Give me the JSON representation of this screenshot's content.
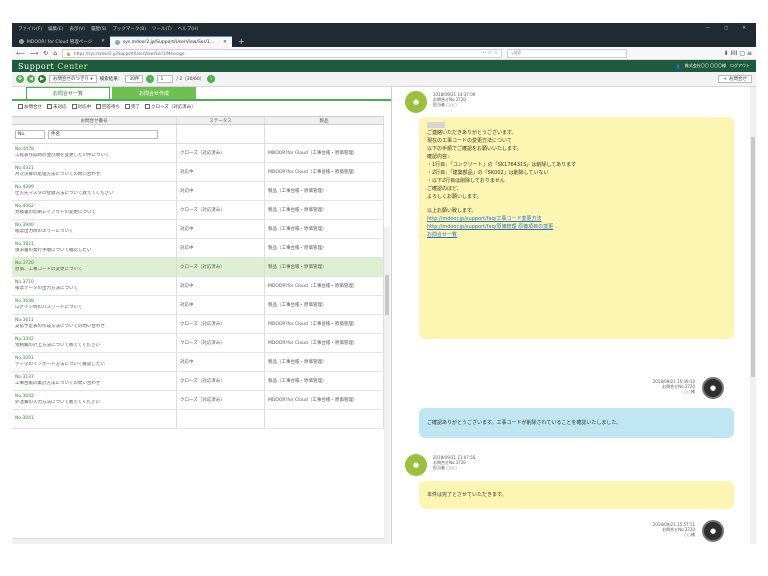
{
  "browser": {
    "menu": [
      "ファイル(F)",
      "編集(E)",
      "表示(V)",
      "履歴(S)",
      "ブックマーク(B)",
      "ツール(T)",
      "ヘルプ(H)"
    ],
    "window_controls": [
      "—",
      "□",
      "✕"
    ],
    "tabs": [
      {
        "label": "MDOOR! for Cloud 管理ページ",
        "active": false
      },
      {
        "label": "sys.mdoor2.jp/Support/UserView/Ser/1...",
        "active": true
      }
    ],
    "new_tab": "+",
    "address": "https://sys.mdoor2.jp/Support/UserView/Ser/1/Message",
    "page_actions": "··· ☆ ☆",
    "search_placeholder": "検索",
    "nav_right": "⬇ IIII ▢ ≡"
  },
  "app": {
    "logo_a": "Support",
    "logo_b": "Center",
    "user": "株式会社〇〇 〇〇〇様",
    "logout": "ログアウト"
  },
  "toolbar": {
    "category": "お問合せのつきり ▾",
    "results_label": "検索結果：",
    "results_count": "30件",
    "page_value": "1",
    "page_total": "/ 2（30/60）",
    "right_button": "お問合せ"
  },
  "left": {
    "tabs": [
      "お問合せ一覧",
      "お問合せ作成"
    ],
    "filters": [
      "お問合せ",
      "未対応",
      "対応中",
      "回答待ち",
      "完了",
      "クローズ（対応済み）"
    ],
    "columns": [
      "お問合せ番号",
      "ステータス",
      "製品"
    ],
    "filter_no": "No.",
    "filter_title": "件名",
    "rows": [
      {
        "no": "No.4478",
        "title": "工程表作成時の並び順を変更したい件について",
        "status": "クローズ（対応済み）",
        "product": "MDOOR!for Cloud（工事台帳・原価管理）",
        "hl": false
      },
      {
        "no": "No.4321",
        "title": "月次決算の処理方法についての問い合わせ",
        "status": "対応中",
        "product": "MDOOR!for Cloud（工事台帳・原価管理）",
        "hl": false
      },
      {
        "no": "No.4099",
        "title": "仕入先マスタの登録方法について教えてください",
        "status": "対応中",
        "product": "製品（工事台帳・原価管理）",
        "hl": false
      },
      {
        "no": "No.4062",
        "title": "見積書の印刷レイアウトの変更について",
        "status": "クローズ（対応済み）",
        "product": "製品（工事台帳・原価管理）",
        "hl": false
      },
      {
        "no": "No.3940",
        "title": "帳票出力時のエラーについて",
        "status": "対応中",
        "product": "製品（工事台帳・原価管理）",
        "hl": false
      },
      {
        "no": "No.3821",
        "title": "請求書の発行手順について確認したい",
        "status": "対応中",
        "product": "製品（工事台帳・原価管理）",
        "hl": false
      },
      {
        "no": "No.3720",
        "title": "原価、工事コードの変更について",
        "status": "クローズ（対応済み）",
        "product": "製品（工事台帳・原価管理）",
        "hl": true
      },
      {
        "no": "No.3710",
        "title": "帳票データの出力方法について",
        "status": "対応中",
        "product": "MDOOR!for Cloud（工事台帳・原価管理）",
        "hl": false
      },
      {
        "no": "No.3638",
        "title": "ログイン時のパスワードについて",
        "status": "対応中",
        "product": "製品（工事台帳・原価管理）",
        "hl": false
      },
      {
        "no": "No.3611",
        "title": "支払予定表の作成方法についての問い合わせ",
        "status": "クローズ（対応済み）",
        "product": "MDOOR!for Cloud（工事台帳・原価管理）",
        "hl": false
      },
      {
        "no": "No.3342",
        "title": "労務費の計上方法について教えてください",
        "status": "クローズ（対応済み）",
        "product": "MDOOR!for Cloud（工事台帳・原価管理）",
        "hl": false
      },
      {
        "no": "No.3201",
        "title": "データのインポート方法について確認したい",
        "status": "対応中",
        "product": "製品（工事台帳・原価管理）",
        "hl": false
      },
      {
        "no": "No.3137",
        "title": "工事台帳の集計方法についての問い合わせ",
        "status": "クローズ（対応済み）",
        "product": "製品（工事台帳・原価管理）",
        "hl": false
      },
      {
        "no": "No.3042",
        "title": "外注費の入力方法について教えてください",
        "status": "クローズ（対応済み）",
        "product": "MDOOR!for Cloud（工事台帳・原価管理）",
        "hl": false
      },
      {
        "no": "No.3041",
        "title": "",
        "status": "",
        "product": "",
        "hl": false
      }
    ]
  },
  "chat": {
    "m1_meta": [
      "2018/09/21 14:37:09",
      "お問合せNo.3720",
      "担当者 ○○○"
    ],
    "m1_hidden": "○○○様",
    "m1_lines": [
      "ご連絡いただきありがとうございます。",
      "現在の工事コードの変更方法について",
      "以下の手順でご確認をお願いいたします。",
      "確認内容：",
      "・1行目：「コンクリート」の「SK176431S」は削除してあります",
      "・2行目：「建築部品」の「SK002」は削除していない",
      "・以下2行目は削除しておりません",
      "ご確認のほど、",
      "よろしくお願いします。",
      "",
      "以上お願い致します。"
    ],
    "m1_link1": "http://mdoor.jp/support/faq/工事コード変更方法",
    "m1_link2": "http://mdoor.jp/support/faq/原価管理 原価項目の変更",
    "m1_link3": "お問合せ一覧",
    "m2_meta": [
      "2018/09/21 15:49:10",
      "お問合せNo.3720",
      "○○様"
    ],
    "m2_text": "ご確認ありがとうございます。工事コードが削除されていることを確認いたしました。",
    "m3_meta": [
      "2018/09/21 11:07:55",
      "お問合せNo.3720",
      "担当者 ○○○"
    ],
    "m3_text": "本件は完了とさせていただきます。",
    "m4_meta": [
      "2018/09/21 15:57:11",
      "お問合せNo.3720",
      "○○様"
    ]
  },
  "colors": {
    "app_header": "#1e5a3e",
    "accent_green": "#4caf50",
    "bubble_yellow": "#fdf6b2",
    "bubble_blue": "#bfe6f2",
    "row_highlight": "#dff0d2"
  }
}
